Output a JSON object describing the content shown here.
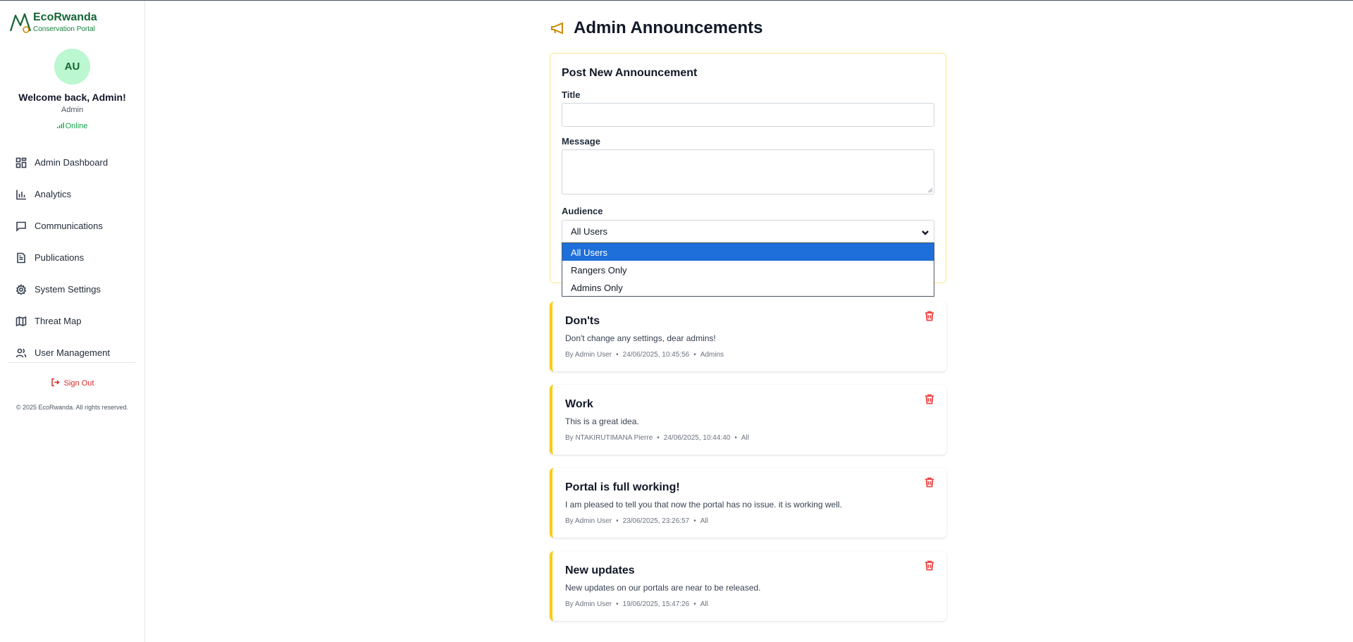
{
  "brand": {
    "name": "EcoRwanda",
    "subtitle": "Conservation Portal"
  },
  "user": {
    "initials": "AU",
    "welcome": "Welcome back, Admin!",
    "role": "Admin",
    "status": "Online"
  },
  "nav": [
    {
      "label": "Admin Dashboard",
      "icon": "dashboard-icon"
    },
    {
      "label": "Analytics",
      "icon": "bar-chart-icon"
    },
    {
      "label": "Communications",
      "icon": "message-icon"
    },
    {
      "label": "Publications",
      "icon": "document-icon"
    },
    {
      "label": "System Settings",
      "icon": "gear-icon"
    },
    {
      "label": "Threat Map",
      "icon": "map-icon"
    },
    {
      "label": "User Management",
      "icon": "users-icon"
    }
  ],
  "signout": "Sign Out",
  "copyright": "© 2025 EcoRwanda. All rights reserved.",
  "page": {
    "title": "Admin Announcements"
  },
  "form": {
    "heading": "Post New Announcement",
    "title_label": "Title",
    "title_value": "",
    "message_label": "Message",
    "message_value": "",
    "audience_label": "Audience",
    "audience_value": "All Users",
    "audience_options": [
      "All Users",
      "Rangers Only",
      "Admins Only"
    ]
  },
  "announcements": [
    {
      "title": "Don'ts",
      "message": "Don't change any settings, dear admins!",
      "author": "By Admin User",
      "date": "24/06/2025, 10:45:56",
      "audience": "Admins"
    },
    {
      "title": "Work",
      "message": "This is a great idea.",
      "author": "By NTAKIRUTIMANA Pierre",
      "date": "24/06/2025, 10:44:40",
      "audience": "All"
    },
    {
      "title": "Portal is full working!",
      "message": "I am pleased to tell you that now the portal has no issue. it is working well.",
      "author": "By Admin User",
      "date": "23/06/2025, 23:26:57",
      "audience": "All"
    },
    {
      "title": "New updates",
      "message": "New updates on our portals are near to be released.",
      "author": "By Admin User",
      "date": "19/06/2025, 15:47:26",
      "audience": "All"
    }
  ],
  "colors": {
    "brand_green": "#166534",
    "accent_yellow": "#facc15",
    "danger": "#ef4444",
    "select_blue": "#1e6fd9"
  }
}
